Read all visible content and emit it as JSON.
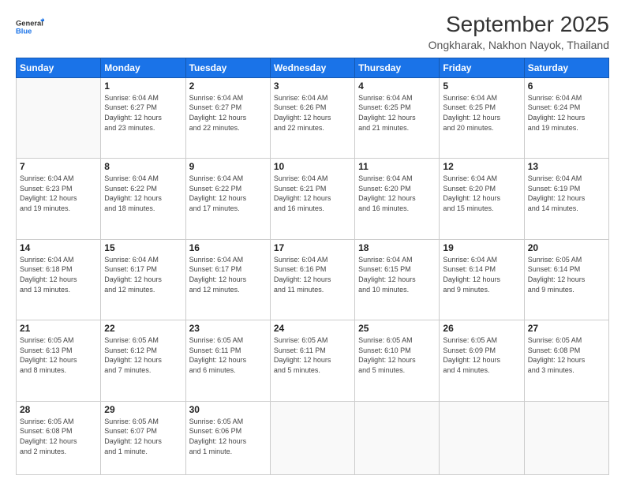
{
  "header": {
    "logo_line1": "General",
    "logo_line2": "Blue",
    "month": "September 2025",
    "location": "Ongkharak, Nakhon Nayok, Thailand"
  },
  "weekdays": [
    "Sunday",
    "Monday",
    "Tuesday",
    "Wednesday",
    "Thursday",
    "Friday",
    "Saturday"
  ],
  "weeks": [
    [
      {
        "day": "",
        "info": ""
      },
      {
        "day": "1",
        "info": "Sunrise: 6:04 AM\nSunset: 6:27 PM\nDaylight: 12 hours\nand 23 minutes."
      },
      {
        "day": "2",
        "info": "Sunrise: 6:04 AM\nSunset: 6:27 PM\nDaylight: 12 hours\nand 22 minutes."
      },
      {
        "day": "3",
        "info": "Sunrise: 6:04 AM\nSunset: 6:26 PM\nDaylight: 12 hours\nand 22 minutes."
      },
      {
        "day": "4",
        "info": "Sunrise: 6:04 AM\nSunset: 6:25 PM\nDaylight: 12 hours\nand 21 minutes."
      },
      {
        "day": "5",
        "info": "Sunrise: 6:04 AM\nSunset: 6:25 PM\nDaylight: 12 hours\nand 20 minutes."
      },
      {
        "day": "6",
        "info": "Sunrise: 6:04 AM\nSunset: 6:24 PM\nDaylight: 12 hours\nand 19 minutes."
      }
    ],
    [
      {
        "day": "7",
        "info": "Sunrise: 6:04 AM\nSunset: 6:23 PM\nDaylight: 12 hours\nand 19 minutes."
      },
      {
        "day": "8",
        "info": "Sunrise: 6:04 AM\nSunset: 6:22 PM\nDaylight: 12 hours\nand 18 minutes."
      },
      {
        "day": "9",
        "info": "Sunrise: 6:04 AM\nSunset: 6:22 PM\nDaylight: 12 hours\nand 17 minutes."
      },
      {
        "day": "10",
        "info": "Sunrise: 6:04 AM\nSunset: 6:21 PM\nDaylight: 12 hours\nand 16 minutes."
      },
      {
        "day": "11",
        "info": "Sunrise: 6:04 AM\nSunset: 6:20 PM\nDaylight: 12 hours\nand 16 minutes."
      },
      {
        "day": "12",
        "info": "Sunrise: 6:04 AM\nSunset: 6:20 PM\nDaylight: 12 hours\nand 15 minutes."
      },
      {
        "day": "13",
        "info": "Sunrise: 6:04 AM\nSunset: 6:19 PM\nDaylight: 12 hours\nand 14 minutes."
      }
    ],
    [
      {
        "day": "14",
        "info": "Sunrise: 6:04 AM\nSunset: 6:18 PM\nDaylight: 12 hours\nand 13 minutes."
      },
      {
        "day": "15",
        "info": "Sunrise: 6:04 AM\nSunset: 6:17 PM\nDaylight: 12 hours\nand 12 minutes."
      },
      {
        "day": "16",
        "info": "Sunrise: 6:04 AM\nSunset: 6:17 PM\nDaylight: 12 hours\nand 12 minutes."
      },
      {
        "day": "17",
        "info": "Sunrise: 6:04 AM\nSunset: 6:16 PM\nDaylight: 12 hours\nand 11 minutes."
      },
      {
        "day": "18",
        "info": "Sunrise: 6:04 AM\nSunset: 6:15 PM\nDaylight: 12 hours\nand 10 minutes."
      },
      {
        "day": "19",
        "info": "Sunrise: 6:04 AM\nSunset: 6:14 PM\nDaylight: 12 hours\nand 9 minutes."
      },
      {
        "day": "20",
        "info": "Sunrise: 6:05 AM\nSunset: 6:14 PM\nDaylight: 12 hours\nand 9 minutes."
      }
    ],
    [
      {
        "day": "21",
        "info": "Sunrise: 6:05 AM\nSunset: 6:13 PM\nDaylight: 12 hours\nand 8 minutes."
      },
      {
        "day": "22",
        "info": "Sunrise: 6:05 AM\nSunset: 6:12 PM\nDaylight: 12 hours\nand 7 minutes."
      },
      {
        "day": "23",
        "info": "Sunrise: 6:05 AM\nSunset: 6:11 PM\nDaylight: 12 hours\nand 6 minutes."
      },
      {
        "day": "24",
        "info": "Sunrise: 6:05 AM\nSunset: 6:11 PM\nDaylight: 12 hours\nand 5 minutes."
      },
      {
        "day": "25",
        "info": "Sunrise: 6:05 AM\nSunset: 6:10 PM\nDaylight: 12 hours\nand 5 minutes."
      },
      {
        "day": "26",
        "info": "Sunrise: 6:05 AM\nSunset: 6:09 PM\nDaylight: 12 hours\nand 4 minutes."
      },
      {
        "day": "27",
        "info": "Sunrise: 6:05 AM\nSunset: 6:08 PM\nDaylight: 12 hours\nand 3 minutes."
      }
    ],
    [
      {
        "day": "28",
        "info": "Sunrise: 6:05 AM\nSunset: 6:08 PM\nDaylight: 12 hours\nand 2 minutes."
      },
      {
        "day": "29",
        "info": "Sunrise: 6:05 AM\nSunset: 6:07 PM\nDaylight: 12 hours\nand 1 minute."
      },
      {
        "day": "30",
        "info": "Sunrise: 6:05 AM\nSunset: 6:06 PM\nDaylight: 12 hours\nand 1 minute."
      },
      {
        "day": "",
        "info": ""
      },
      {
        "day": "",
        "info": ""
      },
      {
        "day": "",
        "info": ""
      },
      {
        "day": "",
        "info": ""
      }
    ]
  ]
}
